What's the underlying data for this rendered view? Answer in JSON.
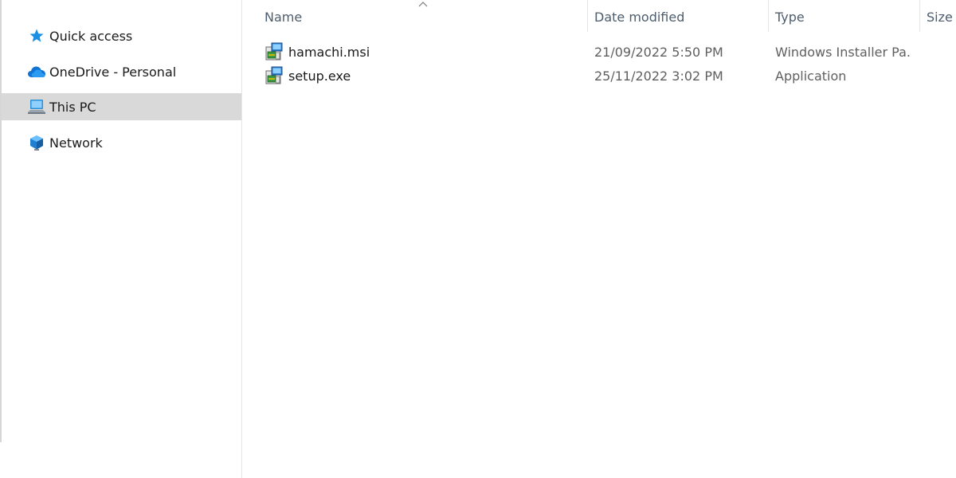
{
  "sidebar": {
    "items": [
      {
        "label": "Quick access",
        "icon": "star-icon"
      },
      {
        "label": "OneDrive - Personal",
        "icon": "cloud-icon"
      },
      {
        "label": "This PC",
        "icon": "computer-icon",
        "selected": true
      },
      {
        "label": "Network",
        "icon": "network-icon"
      }
    ]
  },
  "file_list": {
    "columns": {
      "name": "Name",
      "date": "Date modified",
      "type": "Type",
      "size": "Size"
    },
    "sort": {
      "column": "Name",
      "direction": "ascending"
    },
    "rows": [
      {
        "name": "hamachi.msi",
        "date": "21/09/2022 5:50 PM",
        "type": "Windows Installer Pa...",
        "icon": "installer-icon"
      },
      {
        "name": "setup.exe",
        "date": "25/11/2022 3:02 PM",
        "type": "Application",
        "icon": "installer-icon"
      }
    ]
  },
  "colors": {
    "selection": "#d9d9d9",
    "header_text": "#4d5d6e",
    "accent": "#1a8fe3"
  }
}
